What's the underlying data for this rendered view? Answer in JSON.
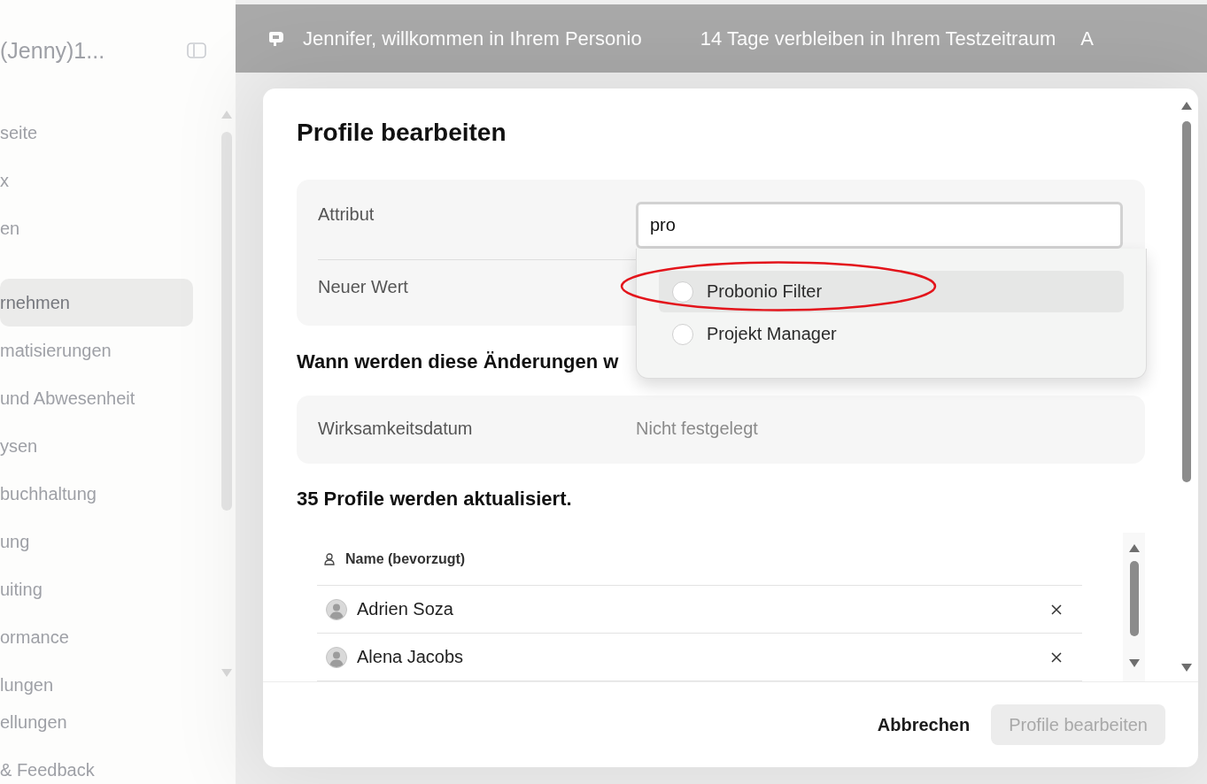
{
  "sidebar": {
    "account": "(Jenny)1...",
    "groups": [
      [
        {
          "label": "seite",
          "selected": false
        },
        {
          "label": "x",
          "selected": false
        },
        {
          "label": "en",
          "selected": false
        }
      ],
      [
        {
          "label": "rnehmen",
          "selected": true
        },
        {
          "label": "matisierungen",
          "selected": false
        },
        {
          "label": "und Abwesenheit",
          "selected": false
        },
        {
          "label": "ysen",
          "selected": false
        },
        {
          "label": "buchhaltung",
          "selected": false
        },
        {
          "label": "ung",
          "selected": false
        },
        {
          "label": "uiting",
          "selected": false
        },
        {
          "label": "ormance",
          "selected": false
        },
        {
          "label": "lungen",
          "selected": false
        }
      ]
    ],
    "footer_items": [
      "ellungen",
      "& Feedback"
    ]
  },
  "banner": {
    "welcome": "Jennifer, willkommen in Ihrem Personio",
    "trial": "14 Tage verbleiben in Ihrem Testzeitraum",
    "action": "A"
  },
  "dialog": {
    "title": "Profile bearbeiten",
    "fields": [
      {
        "label": "Attribut",
        "kind": "input",
        "value": "pro"
      },
      {
        "label": "Neuer Wert",
        "kind": "empty"
      }
    ],
    "dropdown": {
      "options": [
        {
          "label": "Probonio Filter",
          "selected": false,
          "highlighted": true,
          "annotated": true
        },
        {
          "label": "Projekt Manager",
          "selected": false,
          "highlighted": false,
          "annotated": false
        }
      ]
    },
    "schedule_heading": "Wann werden diese Änderungen w",
    "effective": {
      "label": "Wirksamkeitsdatum",
      "value": "Nicht festgelegt"
    },
    "count_text": "35 Profile werden aktualisiert.",
    "table": {
      "column": "Name (bevorzugt)",
      "rows": [
        {
          "name": "Adrien Soza"
        },
        {
          "name": "Alena Jacobs"
        }
      ]
    },
    "buttons": [
      {
        "label": "Abbrechen",
        "kind": "text",
        "disabled": false
      },
      {
        "label": "Profile bearbeiten",
        "kind": "primary",
        "disabled": true
      }
    ]
  }
}
